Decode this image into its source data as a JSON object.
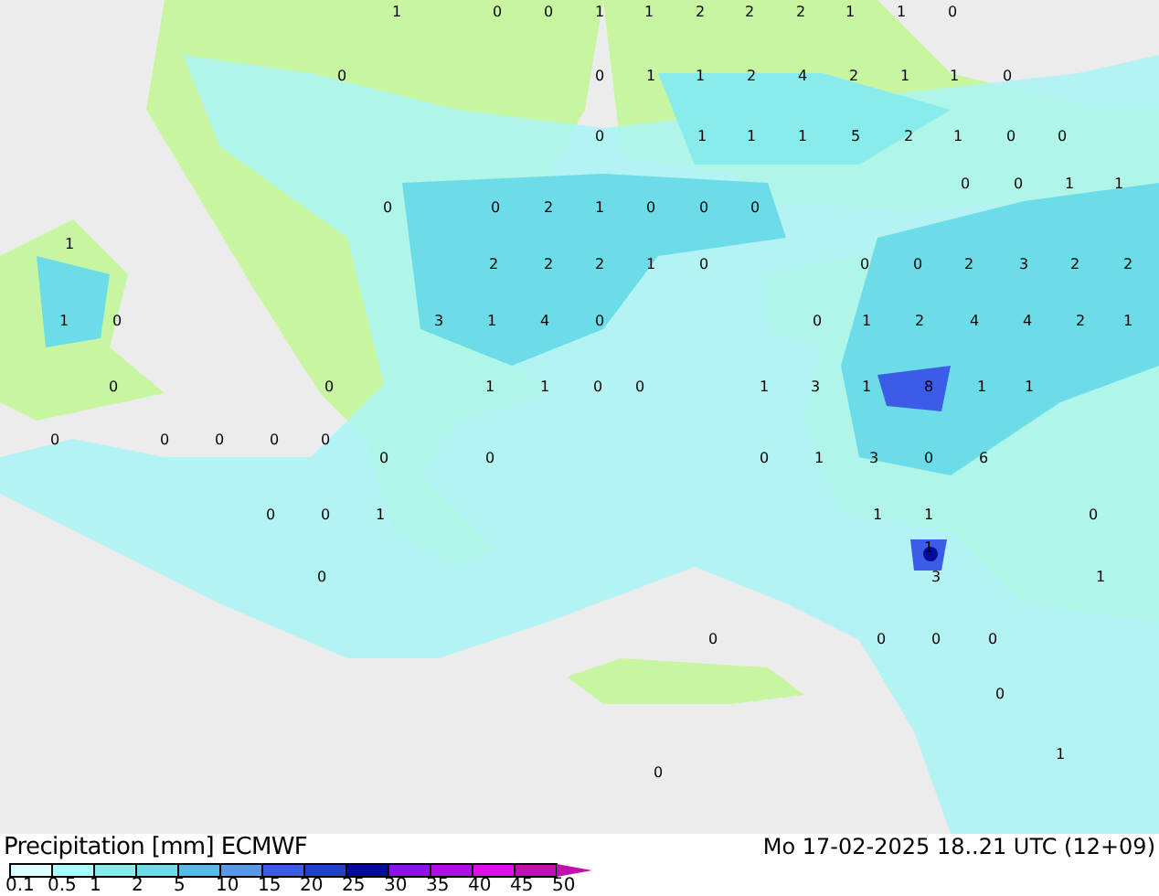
{
  "map": {
    "labels": [
      "1",
      "0",
      "0",
      "1",
      "1",
      "2",
      "2",
      "2",
      "1",
      "1",
      "0",
      "0",
      "0",
      "1",
      "1",
      "2",
      "4",
      "2",
      "1",
      "1",
      "0",
      "0",
      "1",
      "1",
      "1",
      "5",
      "2",
      "1",
      "0",
      "0",
      "0",
      "0",
      "1",
      "1",
      "0",
      "0",
      "2",
      "1",
      "0",
      "0",
      "0",
      "1",
      "2",
      "2",
      "2",
      "1",
      "0",
      "0",
      "0",
      "2",
      "3",
      "2",
      "2",
      "1",
      "0",
      "3",
      "1",
      "4",
      "0",
      "0",
      "1",
      "2",
      "4",
      "4",
      "2",
      "1",
      "0",
      "0",
      "1",
      "1",
      "0",
      "0",
      "1",
      "3",
      "1",
      "8",
      "1",
      "1",
      "0",
      "0",
      "0",
      "0",
      "0",
      "0",
      "0",
      "0",
      "1",
      "3",
      "0",
      "6",
      "0",
      "0",
      "1",
      "1",
      "1",
      "0",
      "1",
      "0",
      "3",
      "1",
      "0",
      "0",
      "0",
      "0",
      "0",
      "1",
      "0"
    ]
  },
  "legend": {
    "title": "Precipitation [mm] ECMWF",
    "steps": [
      {
        "label": "0.1",
        "color": "#dcfefe"
      },
      {
        "label": "0.5",
        "color": "#a8fcfc"
      },
      {
        "label": "1",
        "color": "#88ecec"
      },
      {
        "label": "2",
        "color": "#6cdce8"
      },
      {
        "label": "5",
        "color": "#58bce8"
      },
      {
        "label": "10",
        "color": "#5898e8"
      },
      {
        "label": "15",
        "color": "#3c5ce8"
      },
      {
        "label": "20",
        "color": "#2040c8"
      },
      {
        "label": "25",
        "color": "#000c9c"
      },
      {
        "label": "30",
        "color": "#8c10e8"
      },
      {
        "label": "35",
        "color": "#b010e8"
      },
      {
        "label": "40",
        "color": "#e010e8"
      },
      {
        "label": "45",
        "color": "#c010b0"
      }
    ],
    "end_label": "50"
  },
  "valid_time": "Mo 17-02-2025 18..21 UTC (12+09)"
}
